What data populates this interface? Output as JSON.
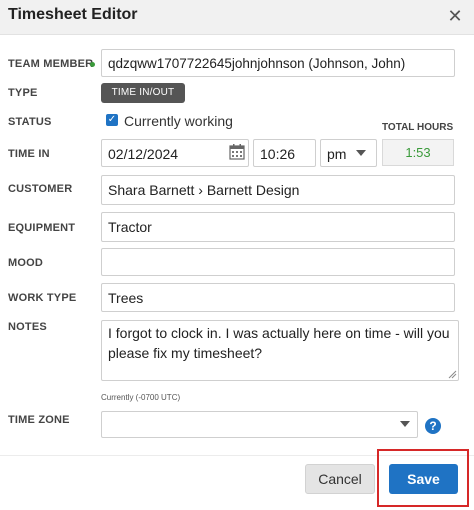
{
  "dialog": {
    "title": "Timesheet Editor",
    "close_icon": "close-icon"
  },
  "team_member": {
    "label": "TEAM MEMBER",
    "value": "qdzqww1707722645johnjohnson (Johnson, John)"
  },
  "type": {
    "label": "TYPE",
    "value": "TIME IN/OUT"
  },
  "status": {
    "label": "STATUS",
    "checkbox_label": "Currently working",
    "checked": true
  },
  "total_hours": {
    "label": "TOTAL HOURS",
    "value": "1:53",
    "color": "#3a9a3a"
  },
  "time_in": {
    "label": "TIME IN",
    "date": "02/12/2024",
    "time": "10:26",
    "ampm": "pm"
  },
  "customer": {
    "label": "CUSTOMER",
    "value": "Shara Barnett › Barnett Design"
  },
  "equipment": {
    "label": "EQUIPMENT",
    "value": "Tractor"
  },
  "mood": {
    "label": "MOOD",
    "value": ""
  },
  "work_type": {
    "label": "WORK TYPE",
    "value": "Trees"
  },
  "notes": {
    "label": "NOTES",
    "value": "I forgot to clock in. I was actually here on time - will you please fix my timesheet?"
  },
  "time_zone": {
    "hint": "Currently (-0700 UTC)",
    "label": "TIME ZONE",
    "value": ""
  },
  "footer": {
    "cancel_label": "Cancel",
    "save_label": "Save"
  },
  "colors": {
    "accent": "#1f73c4",
    "highlight": "#d62828",
    "status_green": "#3a9a3a"
  }
}
